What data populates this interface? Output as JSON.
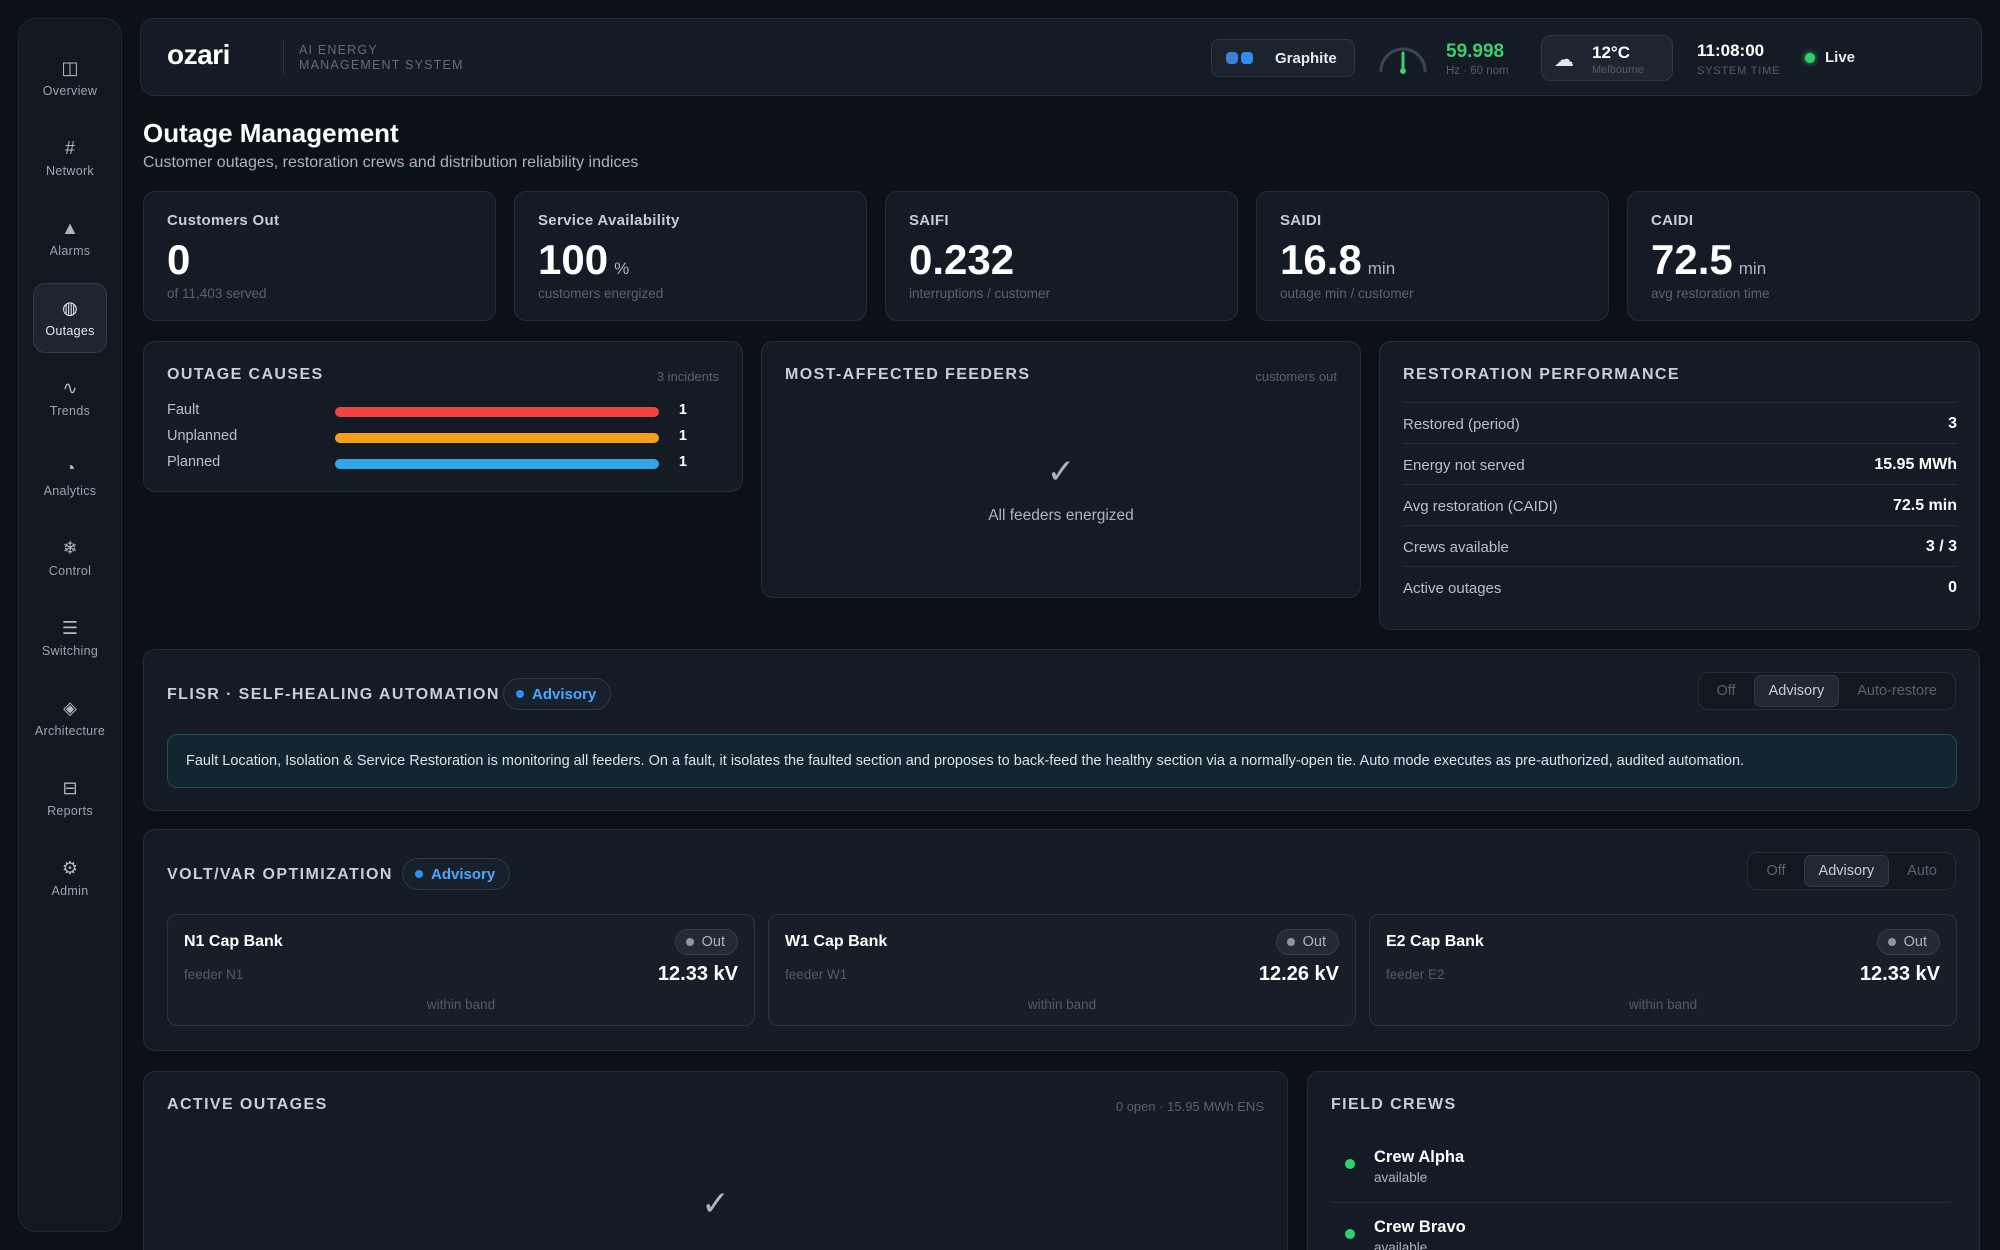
{
  "nav": {
    "items": [
      {
        "label": "Overview",
        "icon": "◫"
      },
      {
        "label": "Network",
        "icon": "#"
      },
      {
        "label": "Alarms",
        "icon": "▲"
      },
      {
        "label": "Outages",
        "icon": "◍"
      },
      {
        "label": "Trends",
        "icon": "∿"
      },
      {
        "label": "Analytics",
        "icon": "◔"
      },
      {
        "label": "Control",
        "icon": "❄"
      },
      {
        "label": "Switching",
        "icon": "☰"
      },
      {
        "label": "Architecture",
        "icon": "◈"
      },
      {
        "label": "Reports",
        "icon": "⊟"
      },
      {
        "label": "Admin",
        "icon": "⚙"
      }
    ],
    "active": "Outages"
  },
  "header": {
    "logo": "ozari",
    "subtitle_line1": "AI ENERGY",
    "subtitle_line2": "MANAGEMENT SYSTEM",
    "theme_label": "Graphite",
    "frequency": "59.998",
    "frequency_sub": "Hz · 60 nom",
    "temperature": "12°C",
    "location": "Melbourne",
    "time": "11:08:00",
    "time_sub": "SYSTEM TIME",
    "live_label": "Live"
  },
  "page": {
    "title": "Outage Management",
    "subtitle": "Customer outages, restoration crews and distribution reliability indices"
  },
  "kpis": [
    {
      "label": "Customers Out",
      "value": "0",
      "unit": "",
      "sub": "of 11,403 served"
    },
    {
      "label": "Service Availability",
      "value": "100",
      "unit": "%",
      "sub": "customers energized"
    },
    {
      "label": "SAIFI",
      "value": "0.232",
      "unit": "",
      "sub": "interruptions / customer"
    },
    {
      "label": "SAIDI",
      "value": "16.8",
      "unit": "min",
      "sub": "outage min / customer"
    },
    {
      "label": "CAIDI",
      "value": "72.5",
      "unit": "min",
      "sub": "avg restoration time"
    }
  ],
  "outage_causes": {
    "title": "Outage Causes",
    "meta": "3 incidents",
    "rows": [
      {
        "label": "Fault",
        "count": "1",
        "fraction": 1.0,
        "color": "#ef4340"
      },
      {
        "label": "Unplanned",
        "count": "1",
        "fraction": 1.0,
        "color": "#f5a01a"
      },
      {
        "label": "Planned",
        "count": "1",
        "fraction": 1.0,
        "color": "#2ea6e8"
      }
    ]
  },
  "feeders": {
    "title": "Most-Affected Feeders",
    "meta": "customers out",
    "empty_icon": "✓",
    "empty_text": "All feeders energized"
  },
  "restoration": {
    "title": "Restoration Performance",
    "rows": [
      {
        "label": "Restored (period)",
        "value": "3"
      },
      {
        "label": "Energy not served",
        "value": "15.95 MWh"
      },
      {
        "label": "Avg restoration (CAIDI)",
        "value": "72.5 min"
      },
      {
        "label": "Crews available",
        "value": "3 / 3"
      },
      {
        "label": "Active outages",
        "value": "0"
      }
    ]
  },
  "flisr": {
    "title": "FLISR · Self-Healing Automation",
    "mode_pill": "Advisory",
    "modes": [
      "Off",
      "Advisory",
      "Auto-restore"
    ],
    "selected_mode": "Advisory",
    "note": "Fault Location, Isolation & Service Restoration is monitoring all feeders. On a fault, it isolates the faulted section and proposes to back-feed the healthy section via a normally-open tie. Auto mode executes as pre-authorized, audited automation."
  },
  "voltvar": {
    "title": "Volt/VAR Optimization",
    "mode_pill": "Advisory",
    "modes": [
      "Off",
      "Advisory",
      "Auto"
    ],
    "selected_mode": "Advisory",
    "banks": [
      {
        "name": "N1 Cap Bank",
        "feeder": "feeder N1",
        "status": "Out",
        "kv": "12.33 kV",
        "note": "within band"
      },
      {
        "name": "W1 Cap Bank",
        "feeder": "feeder W1",
        "status": "Out",
        "kv": "12.26 kV",
        "note": "within band"
      },
      {
        "name": "E2 Cap Bank",
        "feeder": "feeder E2",
        "status": "Out",
        "kv": "12.33 kV",
        "note": "within band"
      }
    ]
  },
  "active_outages": {
    "title": "Active Outages",
    "meta": "0 open · 15.95 MWh ENS",
    "empty_icon": "✓"
  },
  "field_crews": {
    "title": "Field Crews",
    "crews": [
      {
        "name": "Crew Alpha",
        "status": "available"
      },
      {
        "name": "Crew Bravo",
        "status": "available"
      }
    ]
  },
  "colors": {
    "accent": "#2f8ff0",
    "ok": "#2fd16a",
    "freq": "#3ccf6e"
  }
}
